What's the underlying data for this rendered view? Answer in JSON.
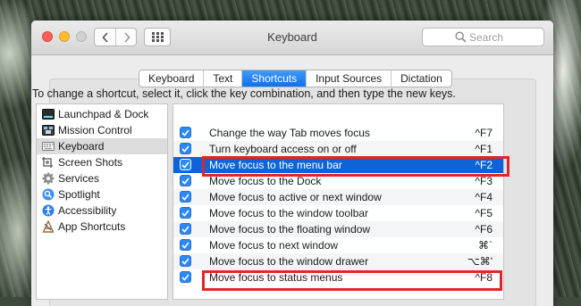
{
  "window": {
    "title": "Keyboard"
  },
  "search": {
    "placeholder": "Search"
  },
  "tabs": [
    {
      "label": "Keyboard",
      "active": false
    },
    {
      "label": "Text",
      "active": false
    },
    {
      "label": "Shortcuts",
      "active": true
    },
    {
      "label": "Input Sources",
      "active": false
    },
    {
      "label": "Dictation",
      "active": false
    }
  ],
  "instructions": "To change a shortcut, select it, click the key combination, and then type the new keys.",
  "categories": [
    {
      "label": "Launchpad & Dock",
      "icon": "launchpad-icon"
    },
    {
      "label": "Mission Control",
      "icon": "mission-control-icon"
    },
    {
      "label": "Keyboard",
      "icon": "keyboard-icon",
      "selected": true
    },
    {
      "label": "Screen Shots",
      "icon": "screenshot-icon"
    },
    {
      "label": "Services",
      "icon": "gear-icon"
    },
    {
      "label": "Spotlight",
      "icon": "spotlight-icon"
    },
    {
      "label": "Accessibility",
      "icon": "accessibility-icon"
    },
    {
      "label": "App Shortcuts",
      "icon": "app-shortcuts-icon"
    }
  ],
  "shortcuts": [
    {
      "label": "Change the way Tab moves focus",
      "key": "^F7",
      "checked": true
    },
    {
      "label": "Turn keyboard access on or off",
      "key": "^F1",
      "checked": true
    },
    {
      "label": "Move focus to the menu bar",
      "key": "^F2",
      "checked": true,
      "selected": true
    },
    {
      "label": "Move focus to the Dock",
      "key": "^F3",
      "checked": true
    },
    {
      "label": "Move focus to active or next window",
      "key": "^F4",
      "checked": true
    },
    {
      "label": "Move focus to the window toolbar",
      "key": "^F5",
      "checked": true
    },
    {
      "label": "Move focus to the floating window",
      "key": "^F6",
      "checked": true
    },
    {
      "label": "Move focus to next window",
      "key": "⌘`",
      "checked": true
    },
    {
      "label": "Move focus to the window drawer",
      "key": "⌥⌘'",
      "checked": true
    },
    {
      "label": "Move focus to status menus",
      "key": "^F8",
      "checked": true
    }
  ],
  "colors": {
    "accent": "#0f63d8",
    "highlight_box": "#e0262a"
  }
}
